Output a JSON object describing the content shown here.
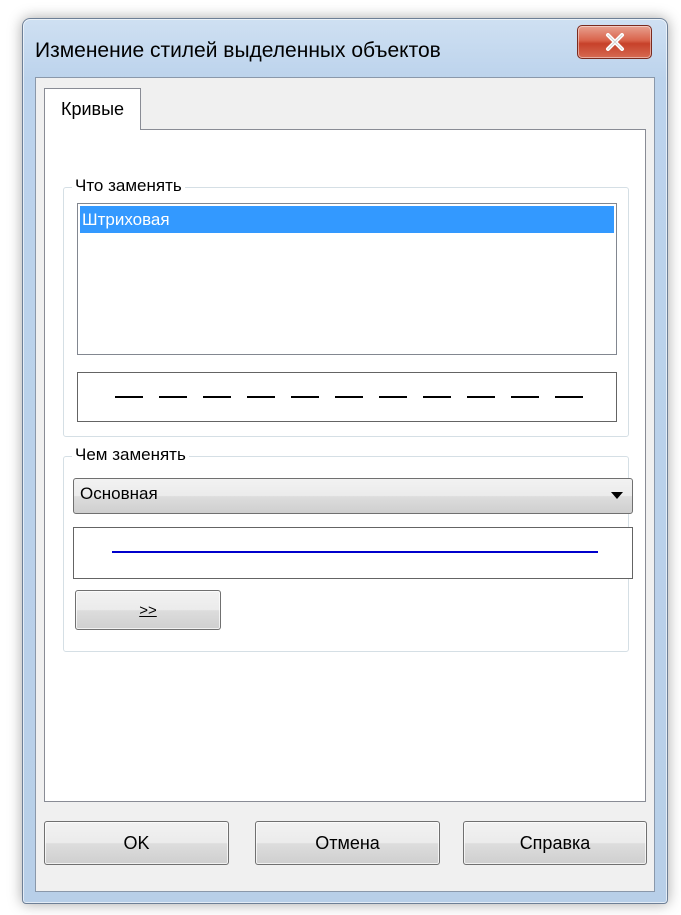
{
  "window": {
    "title": "Изменение стилей выделенных объектов",
    "close_label": "X"
  },
  "tabs": [
    {
      "label": "Кривые",
      "selected": true
    }
  ],
  "what_to_replace": {
    "label": "Что заменять",
    "items": [
      "Штриховая"
    ],
    "selected_index": 0,
    "preview_style": "dashed"
  },
  "replace_with": {
    "label": "Чем заменять",
    "selected_value": "Основная",
    "preview_style": "solid",
    "preview_color": "#0000cc",
    "apply_label": ">>"
  },
  "buttons": {
    "ok": "OK",
    "cancel": "Отмена",
    "help": "Справка"
  },
  "colors": {
    "selection": "#3399ff",
    "preview_line": "#0000cc"
  }
}
